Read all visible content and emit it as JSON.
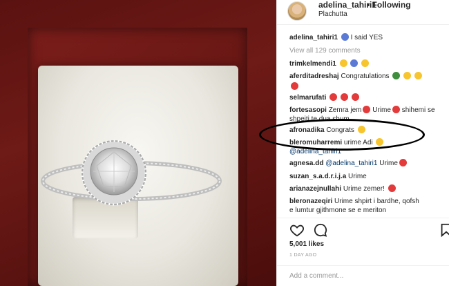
{
  "post": {
    "username": "adelina_tahiri1",
    "separator": "•",
    "follow_status": "Following",
    "location": "Plachutta"
  },
  "caption": {
    "user": "adelina_tahiri1",
    "text": "I said YES"
  },
  "view_all": "View all 129 comments",
  "comments": [
    {
      "user": "trimkelmendi1",
      "text": ""
    },
    {
      "user": "aferditadreshaj",
      "text": "Congratulations"
    },
    {
      "user": "",
      "text": ""
    },
    {
      "user": "selmarufati",
      "text": ""
    },
    {
      "user": "fortesasopi",
      "text": "Zemra jem",
      "text2": "Urime",
      "text3": "shihemi se",
      "line2": "shpejti te dua shum"
    },
    {
      "user": "afronadika",
      "text": "Congrats"
    },
    {
      "user": "bleromuharremi",
      "text": "urime Adi",
      "line2": "@adelina_tahiri1"
    },
    {
      "user": "agnesa.dd",
      "mention": "@adelina_tahiri1",
      "text": "Urime"
    },
    {
      "user": "suzan_s.a.d.r.i.j.a",
      "text": "Urime"
    },
    {
      "user": "arianazejnullahi",
      "text": "Urime zemer!"
    },
    {
      "user": "bleronazeqiri",
      "text": "Urime shpirt i bardhe, qofsh",
      "line2": "e lumtur gjithmone se e meriton"
    }
  ],
  "likes": "5,001 likes",
  "date": "1 DAY AGO",
  "add_comment_placeholder": "Add a comment...",
  "icons": [
    "heart-icon",
    "comment-icon",
    "bookmark-icon"
  ],
  "colors": {
    "mention": "#003569",
    "muted": "#999999",
    "text": "#262626"
  }
}
